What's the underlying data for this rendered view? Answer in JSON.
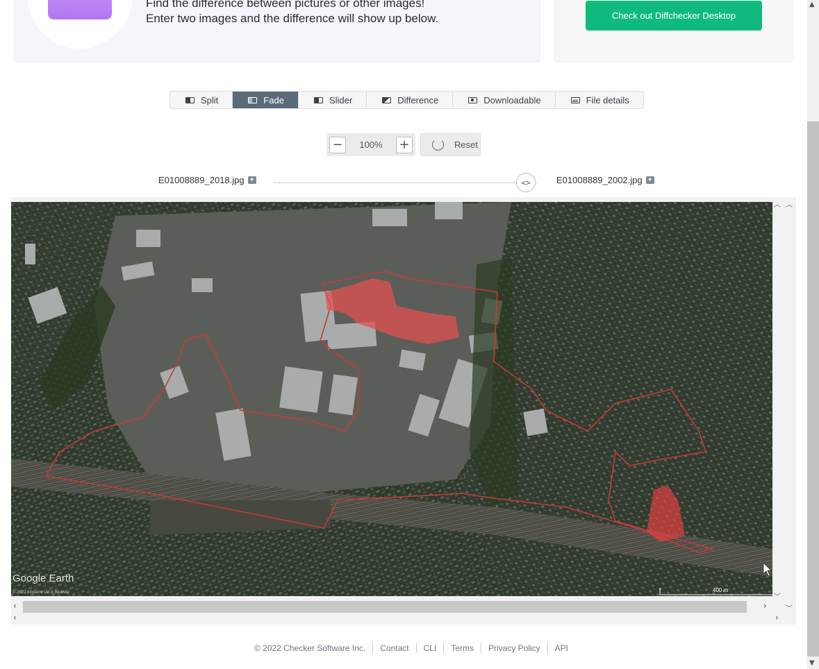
{
  "intro": {
    "line1": "Find the difference between pictures or other images!",
    "line2": "Enter two images and the difference will show up below."
  },
  "promo": {
    "button_label": "Check out Diffchecker Desktop"
  },
  "tabs": [
    {
      "label": "Split",
      "active": false
    },
    {
      "label": "Fade",
      "active": true
    },
    {
      "label": "Slider",
      "active": false
    },
    {
      "label": "Difference",
      "active": false
    },
    {
      "label": "Downloadable",
      "active": false
    },
    {
      "label": "File details",
      "active": false
    }
  ],
  "zoom": {
    "value": "100%",
    "reset_label": "Reset"
  },
  "files": {
    "left": "E01008889_2018.jpg",
    "right": "E01008889_2002.jpg"
  },
  "map": {
    "watermark": "Google Earth",
    "imagery_credit": "© 2022 Infoterra Ltd & Bluesky",
    "scale_label": "400 m"
  },
  "footer": {
    "copyright": "© 2022 Checker Software Inc.",
    "links": [
      "Contact",
      "CLI",
      "Terms",
      "Privacy Policy",
      "API"
    ]
  },
  "colors": {
    "accent": "#10ba7d",
    "active_tab": "#5b6a78",
    "highlight": "#e04040"
  }
}
